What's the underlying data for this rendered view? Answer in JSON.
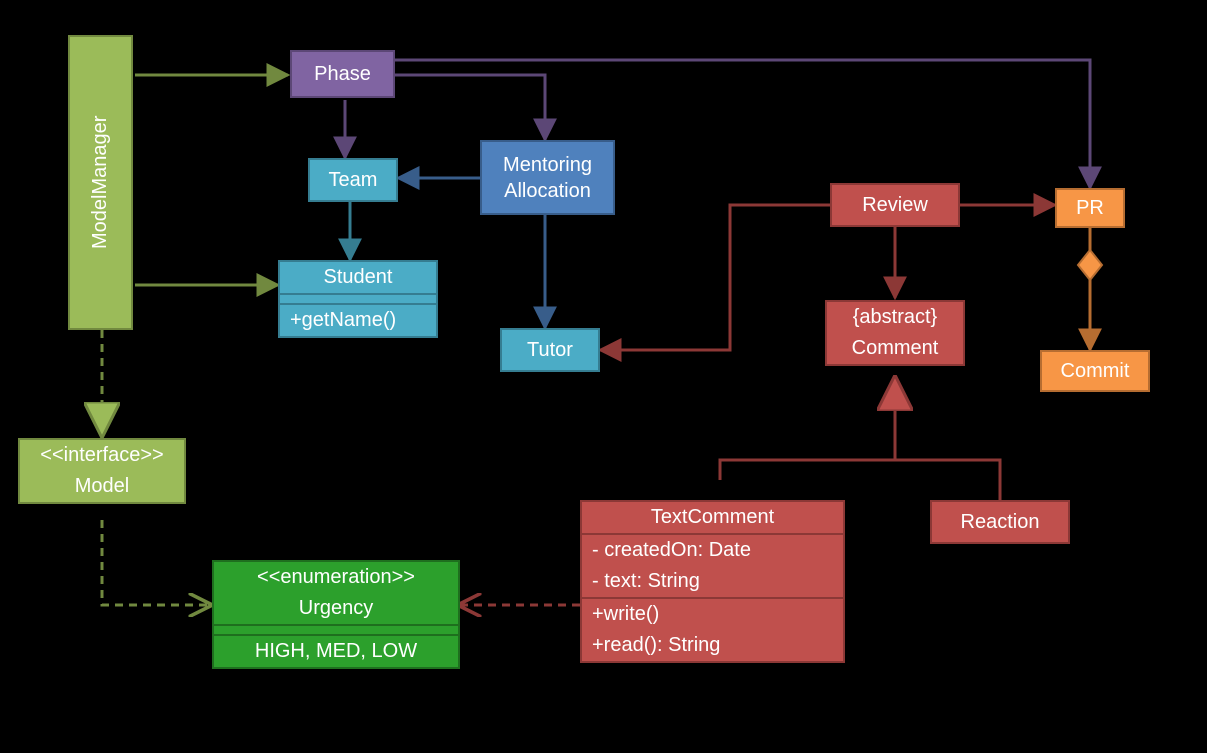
{
  "nodes": {
    "modelManager": "ModelManager",
    "phase": "Phase",
    "team": "Team",
    "mentoring": "Mentoring Allocation",
    "student": {
      "name": "Student",
      "method": "+getName()"
    },
    "tutor": "Tutor",
    "model": {
      "stereo": "<<interface>>",
      "name": "Model"
    },
    "urgency": {
      "stereo": "<<enumeration>>",
      "name": "Urgency",
      "values": "HIGH, MED, LOW"
    },
    "review": "Review",
    "comment": {
      "stereo": "{abstract}",
      "name": "Comment"
    },
    "textComment": {
      "name": "TextComment",
      "attrs": [
        "- createdOn: Date",
        "- text: String"
      ],
      "methods": [
        "+write()",
        "+read(): String"
      ]
    },
    "reaction": "Reaction",
    "pr": "PR",
    "commit": "Commit"
  },
  "chart_data": {
    "type": "diagram",
    "kind": "UML-class-diagram",
    "classes": [
      {
        "id": "ModelManager",
        "color": "olive"
      },
      {
        "id": "Model",
        "stereotype": "interface",
        "color": "olive"
      },
      {
        "id": "Urgency",
        "stereotype": "enumeration",
        "values": [
          "HIGH",
          "MED",
          "LOW"
        ],
        "color": "green"
      },
      {
        "id": "Phase",
        "color": "purple"
      },
      {
        "id": "Team",
        "color": "teal"
      },
      {
        "id": "MentoringAllocation",
        "label": "Mentoring Allocation",
        "color": "blue"
      },
      {
        "id": "Student",
        "methods": [
          "+getName()"
        ],
        "color": "teal"
      },
      {
        "id": "Tutor",
        "color": "teal"
      },
      {
        "id": "Review",
        "color": "red"
      },
      {
        "id": "Comment",
        "stereotype": "abstract",
        "color": "red"
      },
      {
        "id": "TextComment",
        "attributes": [
          "- createdOn: Date",
          "- text: String"
        ],
        "methods": [
          "+write()",
          "+read(): String"
        ],
        "color": "red"
      },
      {
        "id": "Reaction",
        "color": "red"
      },
      {
        "id": "PR",
        "color": "orange"
      },
      {
        "id": "Commit",
        "color": "orange"
      }
    ],
    "relations": [
      {
        "from": "ModelManager",
        "to": "Phase",
        "type": "association",
        "color": "olive"
      },
      {
        "from": "ModelManager",
        "to": "Student",
        "type": "association",
        "color": "olive"
      },
      {
        "from": "ModelManager",
        "to": "Model",
        "type": "realization",
        "style": "dashed",
        "color": "olive"
      },
      {
        "from": "Model",
        "to": "Urgency",
        "type": "dependency",
        "style": "dashed",
        "color": "olive"
      },
      {
        "from": "Phase",
        "to": "Team",
        "type": "association",
        "color": "purple"
      },
      {
        "from": "Phase",
        "to": "MentoringAllocation",
        "type": "association",
        "color": "purple"
      },
      {
        "from": "Phase",
        "to": "PR",
        "type": "association",
        "color": "purple"
      },
      {
        "from": "MentoringAllocation",
        "to": "Team",
        "type": "association",
        "color": "blue"
      },
      {
        "from": "MentoringAllocation",
        "to": "Tutor",
        "type": "association",
        "color": "blue"
      },
      {
        "from": "Team",
        "to": "Student",
        "type": "association",
        "color": "teal"
      },
      {
        "from": "Review",
        "to": "Tutor",
        "type": "association",
        "color": "red"
      },
      {
        "from": "Review",
        "to": "PR",
        "type": "association",
        "color": "red"
      },
      {
        "from": "Review",
        "to": "Comment",
        "type": "association",
        "color": "red"
      },
      {
        "from": "TextComment",
        "to": "Comment",
        "type": "generalization",
        "color": "red"
      },
      {
        "from": "Reaction",
        "to": "Comment",
        "type": "generalization",
        "color": "red"
      },
      {
        "from": "TextComment",
        "to": "Urgency",
        "type": "dependency",
        "style": "dashed",
        "color": "red"
      },
      {
        "from": "PR",
        "to": "Commit",
        "type": "aggregation",
        "color": "orange"
      }
    ]
  }
}
